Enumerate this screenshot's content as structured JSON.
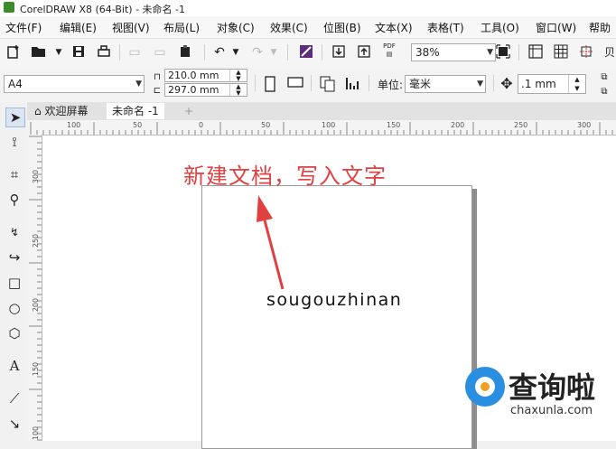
{
  "window": {
    "title": "CorelDRAW X8 (64-Bit) - 未命名 -1"
  },
  "menu": [
    {
      "label": "文件(F)"
    },
    {
      "label": "编辑(E)"
    },
    {
      "label": "视图(V)"
    },
    {
      "label": "布局(L)"
    },
    {
      "label": "对象(C)"
    },
    {
      "label": "效果(C)"
    },
    {
      "label": "位图(B)"
    },
    {
      "label": "文本(X)"
    },
    {
      "label": "表格(T)"
    },
    {
      "label": "工具(O)"
    },
    {
      "label": "窗口(W)"
    },
    {
      "label": "帮助"
    }
  ],
  "toolbar": {
    "zoom": "38%",
    "pdf_label": "PDF",
    "partial_label": "贝"
  },
  "property_bar": {
    "page_size": "A4",
    "width": "210.0 mm",
    "height": "297.0 mm",
    "unit_label": "单位:",
    "unit": "毫米",
    "nudge": ".1 mm"
  },
  "tabs": [
    {
      "label": "欢迎屏幕"
    },
    {
      "label": "未命名 -1"
    },
    {
      "label": "+"
    }
  ],
  "rulers": {
    "horizontal": [
      "100",
      "50",
      "0",
      "50",
      "100",
      "150",
      "200",
      "250",
      "300"
    ],
    "vertical": [
      "300",
      "250",
      "200",
      "150",
      "100"
    ]
  },
  "canvas": {
    "annotation": "新建文档，写入文字",
    "document_text": "sougouzhinan"
  },
  "watermark": {
    "name": "查询啦",
    "url": "chaxunla.com"
  },
  "icons": [
    "new-doc-icon",
    "open-icon",
    "save-icon",
    "print-icon",
    "undo-icon",
    "redo-icon",
    "import-icon",
    "export-icon",
    "pdf-icon",
    "fullscreen-icon",
    "selection-icon",
    "shape-icon",
    "crop-icon",
    "zoom-icon",
    "freehand-icon",
    "artistic-media-icon",
    "rectangle-icon",
    "ellipse-icon",
    "polygon-icon",
    "text-icon",
    "connector-icon",
    "home-icon"
  ],
  "colors": {
    "annotation": "#e04040",
    "arrow": "#e04040",
    "logo_blue": "#2a8fe0",
    "logo_orange": "#f0a020"
  }
}
